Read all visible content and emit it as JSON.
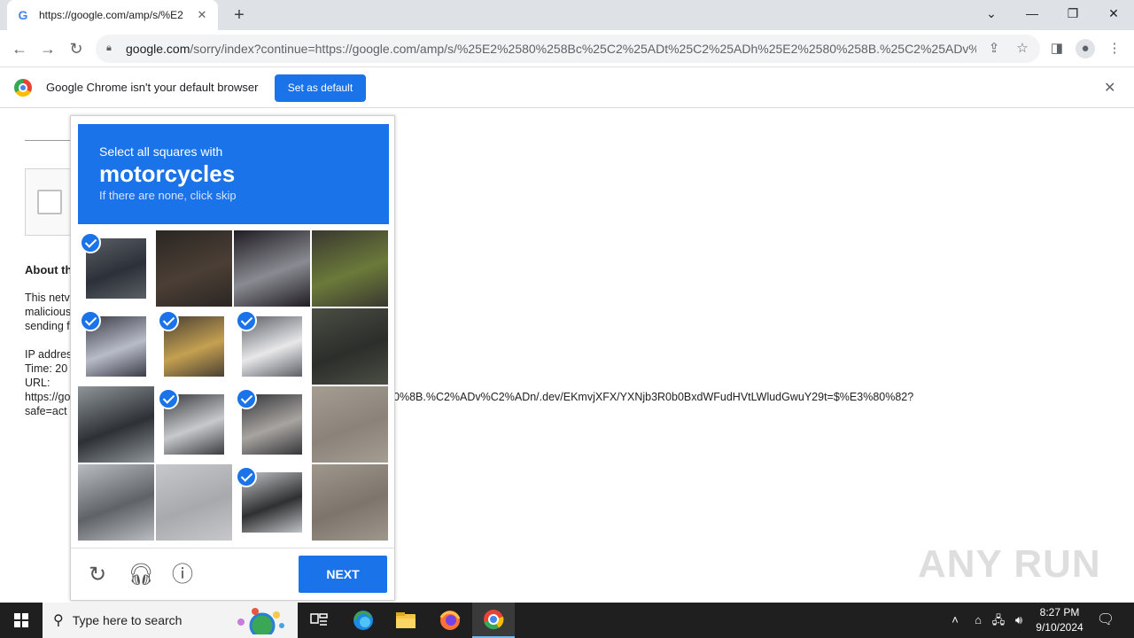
{
  "tab": {
    "favicon": "G",
    "title": "https://google.com/amp/s/%E2",
    "close": "✕"
  },
  "toolbar": {
    "url_host": "google.com",
    "url_rest": "/sorry/index?continue=https://google.com/amp/s/%25E2%2580%258Bc%25C2%25ADt%25C2%25ADh%25E2%2580%258B.%25C2%25ADv%2..."
  },
  "infobar": {
    "message": "Google Chrome isn't your default browser",
    "set_default": "Set as default"
  },
  "page": {
    "about_heading": "About th",
    "line1": "This netv",
    "line2": "malicious",
    "line3": "sending f",
    "ip_label": "IP addres",
    "time_label": "Time: 20",
    "url_label": "URL:",
    "url_start": "https://go",
    "safe_label": "safe=act",
    "url_tail": "0%8B.%C2%ADv%C2%ADn/.dev/EKmvjXFX/YXNjb3R0b0BxdWFudHVtLWludGwuY29t=$%E3%80%82?"
  },
  "captcha": {
    "instruction": "Select all squares with",
    "target": "motorcycles",
    "hint": "If there are none, click skip",
    "tiles": [
      {
        "selected": true,
        "color": "#5a5f66",
        "accent": "#2c3038"
      },
      {
        "selected": false,
        "color": "#2a2623",
        "accent": "#4b3f35"
      },
      {
        "selected": false,
        "color": "#1f1d22",
        "accent": "#8a8a92"
      },
      {
        "selected": false,
        "color": "#3a3830",
        "accent": "#6b7a3a"
      },
      {
        "selected": true,
        "color": "#3a3d48",
        "accent": "#b8bcc8"
      },
      {
        "selected": true,
        "color": "#4a4034",
        "accent": "#c4a050"
      },
      {
        "selected": true,
        "color": "#5e6068",
        "accent": "#e8e8ea"
      },
      {
        "selected": false,
        "color": "#4b4e44",
        "accent": "#2b2e2a"
      },
      {
        "selected": false,
        "color": "#8f9599",
        "accent": "#2d3135"
      },
      {
        "selected": true,
        "color": "#3b3c40",
        "accent": "#c8c9cc"
      },
      {
        "selected": true,
        "color": "#35363a",
        "accent": "#a8a4a0"
      },
      {
        "selected": false,
        "color": "#a59c92",
        "accent": "#8b8279"
      },
      {
        "selected": false,
        "color": "#b9bcc0",
        "accent": "#5f6367"
      },
      {
        "selected": false,
        "color": "#c6c8cb",
        "accent": "#a7a9ac"
      },
      {
        "selected": true,
        "color": "#bfc2c5",
        "accent": "#2f3032"
      },
      {
        "selected": false,
        "color": "#9f968c",
        "accent": "#7d756c"
      }
    ],
    "next_label": "NEXT"
  },
  "watermark": "ANY RUN",
  "taskbar": {
    "search_placeholder": "Type here to search",
    "time": "8:27 PM",
    "date": "9/10/2024"
  }
}
